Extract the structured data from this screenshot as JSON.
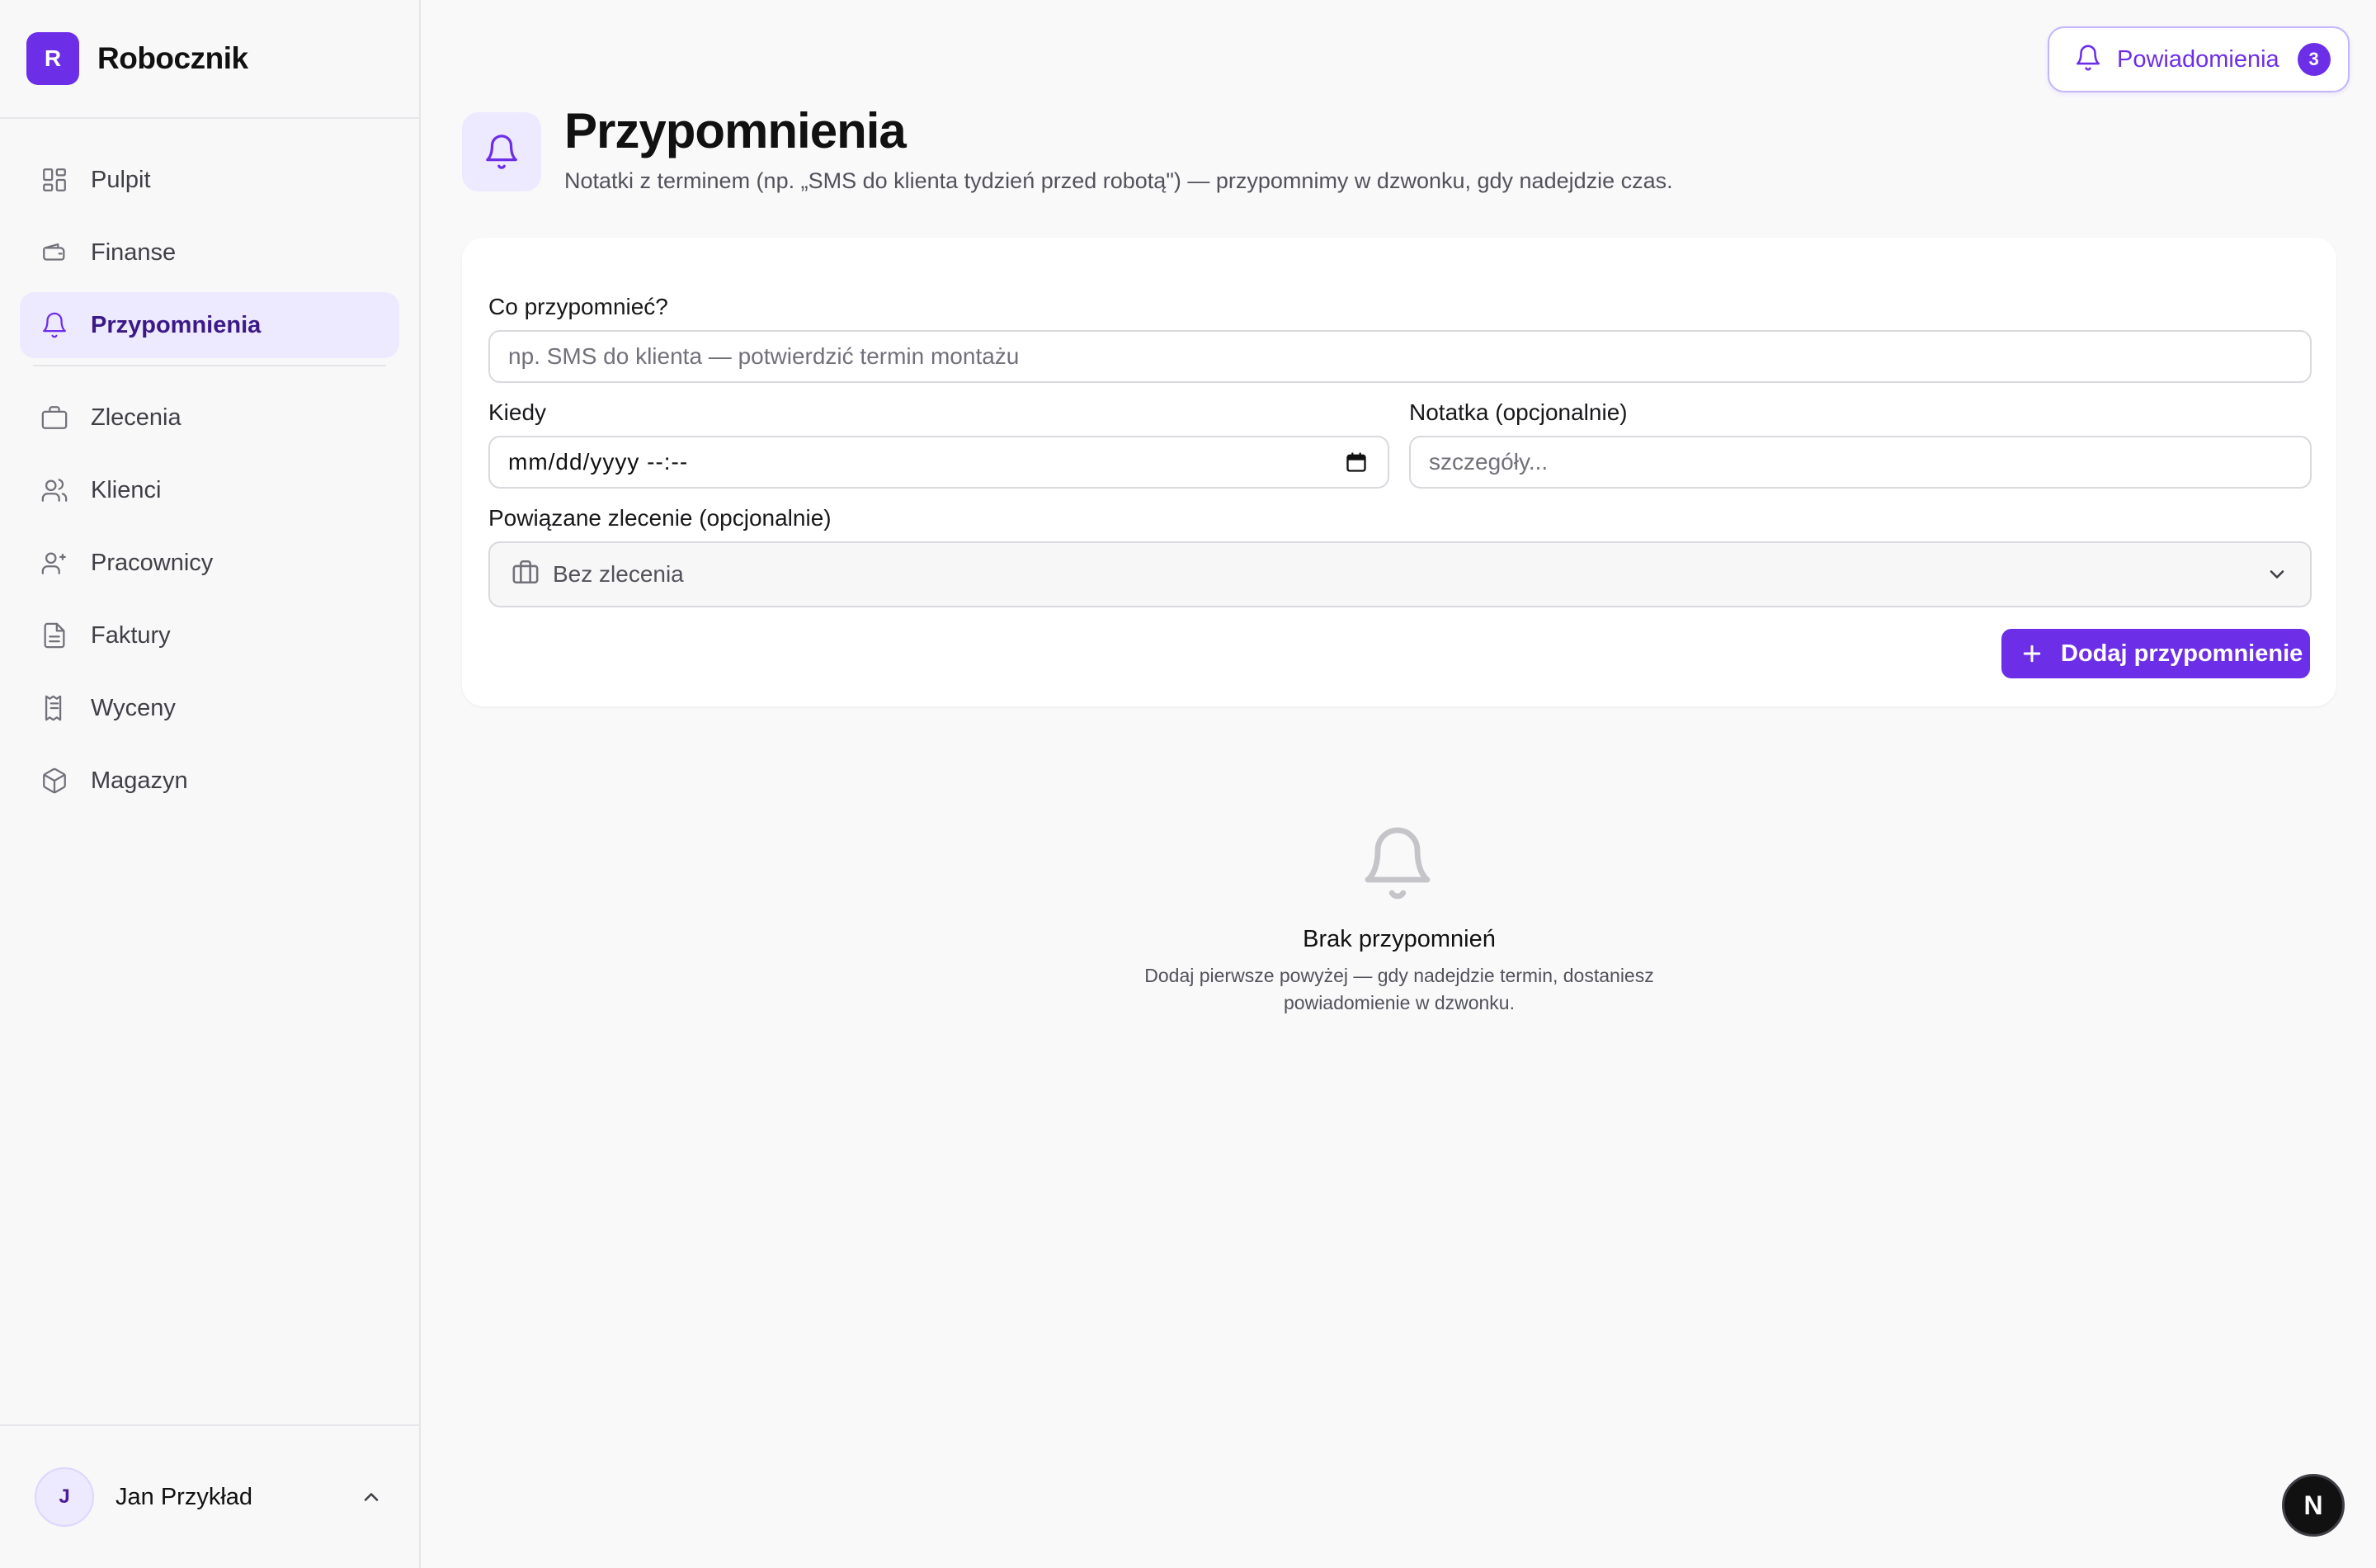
{
  "brand": {
    "logo_letter": "R",
    "name": "Robocznik"
  },
  "nav": {
    "primary": [
      {
        "label": "Pulpit",
        "icon": "dashboard-grid-icon"
      },
      {
        "label": "Finanse",
        "icon": "wallet-icon"
      },
      {
        "label": "Przypomnienia",
        "icon": "bell-icon",
        "active": true
      }
    ],
    "secondary": [
      {
        "label": "Zlecenia",
        "icon": "briefcase-icon"
      },
      {
        "label": "Klienci",
        "icon": "users-icon"
      },
      {
        "label": "Pracownicy",
        "icon": "user-plus-icon"
      },
      {
        "label": "Faktury",
        "icon": "document-icon"
      },
      {
        "label": "Wyceny",
        "icon": "receipt-icon"
      },
      {
        "label": "Magazyn",
        "icon": "package-icon"
      }
    ]
  },
  "user": {
    "initial": "J",
    "name": "Jan Przykład"
  },
  "notifications": {
    "label": "Powiadomienia",
    "count": "3"
  },
  "page": {
    "title": "Przypomnienia",
    "subtitle": "Notatki z terminem (np. „SMS do klienta tydzień przed robotą\") — przypomnimy w dzwonku, gdy nadejdzie czas."
  },
  "form": {
    "what_label": "Co przypomnieć?",
    "what_placeholder": "np. SMS do klienta — potwierdzić termin montażu",
    "when_label": "Kiedy",
    "when_value": "mm/dd/yyyy --:--",
    "note_label": "Notatka (opcjonalnie)",
    "note_placeholder": "szczegóły...",
    "job_label": "Powiązane zlecenie (opcjonalnie)",
    "job_value": "Bez zlecenia",
    "submit_label": "Dodaj przypomnienie"
  },
  "empty": {
    "title": "Brak przypomnień",
    "desc_line1": "Dodaj pierwsze powyżej — gdy nadejdzie termin, dostaniesz",
    "desc_line2": "powiadomienie w dzwonku."
  },
  "dev_badge": {
    "letter": "N"
  },
  "colors": {
    "accent": "#6d2ee8",
    "accent_soft": "#ede9fe",
    "border": "#e6e6ea"
  }
}
